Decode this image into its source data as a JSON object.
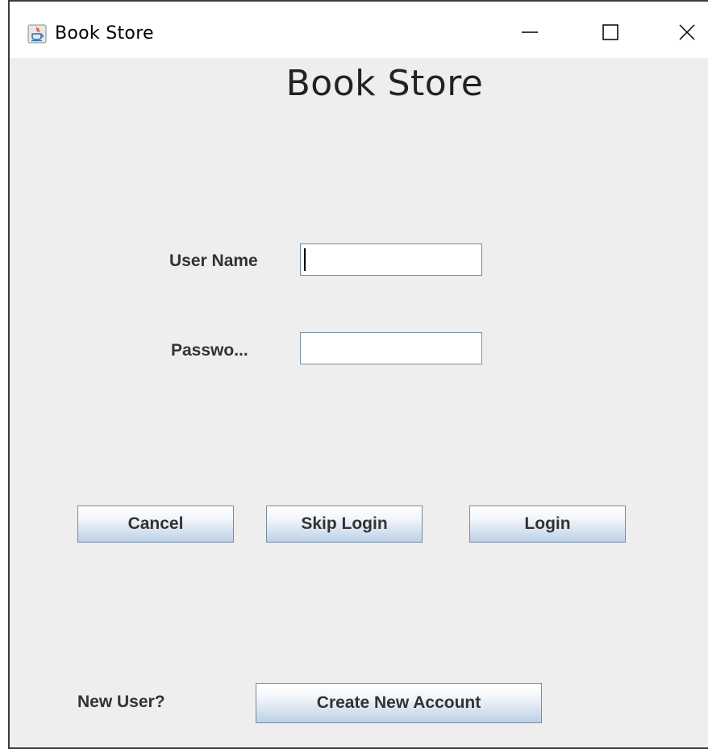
{
  "window": {
    "title": "Book Store",
    "app_icon": "java-cup-icon",
    "controls": {
      "minimize_icon": "minimize-icon",
      "maximize_icon": "maximize-icon",
      "close_icon": "close-icon"
    }
  },
  "header": {
    "title": "Book Store"
  },
  "form": {
    "username_label": "User Name",
    "username_value": "",
    "password_label": "Passwo...",
    "password_value": ""
  },
  "actions": {
    "cancel_label": "Cancel",
    "skip_login_label": "Skip Login",
    "login_label": "Login"
  },
  "signup": {
    "prompt": "New User?",
    "create_account_label": "Create New Account"
  },
  "colors": {
    "background": "#eeeeee",
    "titlebar": "#ffffff",
    "button_gradient_top": "#ffffff",
    "button_gradient_bottom": "#bcd0e6",
    "label_text": "#333333"
  }
}
